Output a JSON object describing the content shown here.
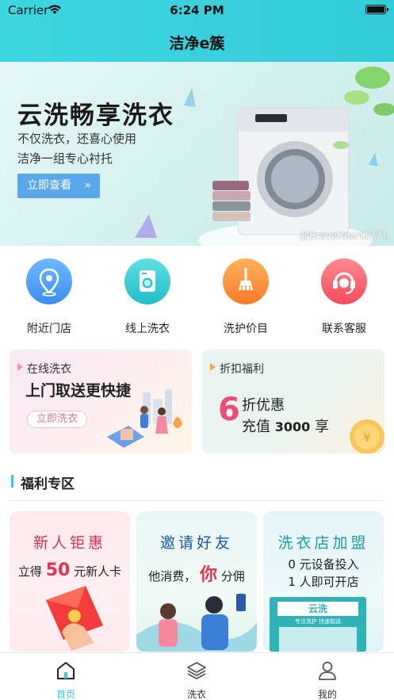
{
  "status_bar": {
    "carrier": "Carrier",
    "time": "6:24 PM"
  },
  "header": {
    "title": "洁净e簇"
  },
  "banner": {
    "title": "云洗畅享洗衣",
    "subtitle_1": "不仅洗衣，还喜心使用",
    "subtitle_2": "洁净一组专心衬托",
    "button_label": "立即查看",
    "watermark": "@BraveHeart1771"
  },
  "quick_links": [
    {
      "label": "附近门店",
      "icon": "location-pin-icon",
      "color": "#4a9ef5"
    },
    {
      "label": "线上洗衣",
      "icon": "washing-machine-icon",
      "color": "#2fc6cf"
    },
    {
      "label": "洗护价目",
      "icon": "broom-icon",
      "color": "#ff8f3d"
    },
    {
      "label": "联系客服",
      "icon": "headset-icon",
      "color": "#fb5a6a"
    }
  ],
  "promos": {
    "left": {
      "tag": "在线洗衣",
      "main": "上门取送更快捷",
      "button": "立即洗衣"
    },
    "right": {
      "tag": "折扣福利",
      "big_number": "6",
      "line1": "折优惠",
      "line2_prefix": "充值",
      "line2_amount": "3000",
      "line2_suffix": "享"
    }
  },
  "section": {
    "title": "福利专区"
  },
  "cards": {
    "newuser": {
      "title": "新人钜惠",
      "pre": "立得",
      "amount": "50",
      "post": "元新人卡"
    },
    "invite": {
      "title": "邀请好友",
      "pre": "他消费，",
      "you": "你",
      "post": "分佣"
    },
    "franchise": {
      "title": "洗衣店加盟",
      "line1": "0 元设备投入",
      "line2": "1 人即可开店",
      "shop_sign": "云洗",
      "shop_sub": "专注洗护 快速取送"
    }
  },
  "tabbar": [
    {
      "label": "首页",
      "icon": "home-icon",
      "active": true
    },
    {
      "label": "洗衣",
      "icon": "layers-icon",
      "active": false
    },
    {
      "label": "我的",
      "icon": "user-icon",
      "active": false
    }
  ],
  "colors": {
    "accent": "#35c8d6",
    "promo_pink": "#e4738b"
  }
}
